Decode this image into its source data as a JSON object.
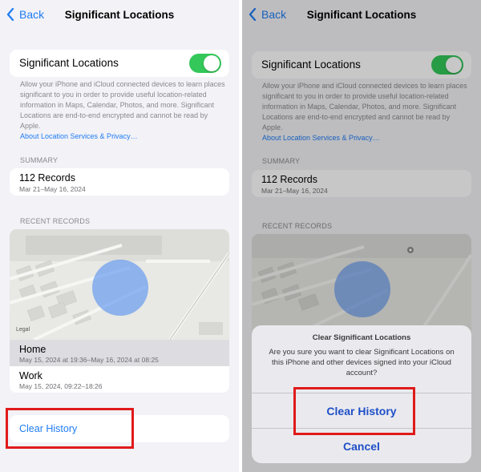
{
  "nav": {
    "back_label": "Back",
    "title": "Significant Locations"
  },
  "toggle": {
    "label": "Significant Locations",
    "on": true,
    "color": "#34c759"
  },
  "description": {
    "text": "Allow your iPhone and iCloud connected devices to learn places significant to you in order to provide useful location-related information in Maps, Calendar, Photos, and more. Significant Locations are end-to-end encrypted and cannot be read by Apple.",
    "link": "About Location Services & Privacy…"
  },
  "summary": {
    "header": "SUMMARY",
    "records": "112 Records",
    "range": "Mar 21–May 16, 2024"
  },
  "recent": {
    "header": "RECENT RECORDS",
    "map_legal": "Legal",
    "items": [
      {
        "title": "Home",
        "detail": "May 15, 2024 at 19:36–May 16, 2024 at 08:25"
      },
      {
        "title": "Work",
        "detail": "May 15, 2024, 09:22–18:26"
      }
    ]
  },
  "clear_history_label": "Clear History",
  "alert": {
    "title": "Clear Significant Locations",
    "message": "Are you sure you want to clear Significant Locations on this iPhone and other devices signed into your iCloud account?",
    "confirm_label": "Clear History",
    "cancel_label": "Cancel"
  },
  "colors": {
    "accent": "#1f7cf2",
    "highlight": "#e01a1a",
    "background": "#f2f2f7"
  }
}
